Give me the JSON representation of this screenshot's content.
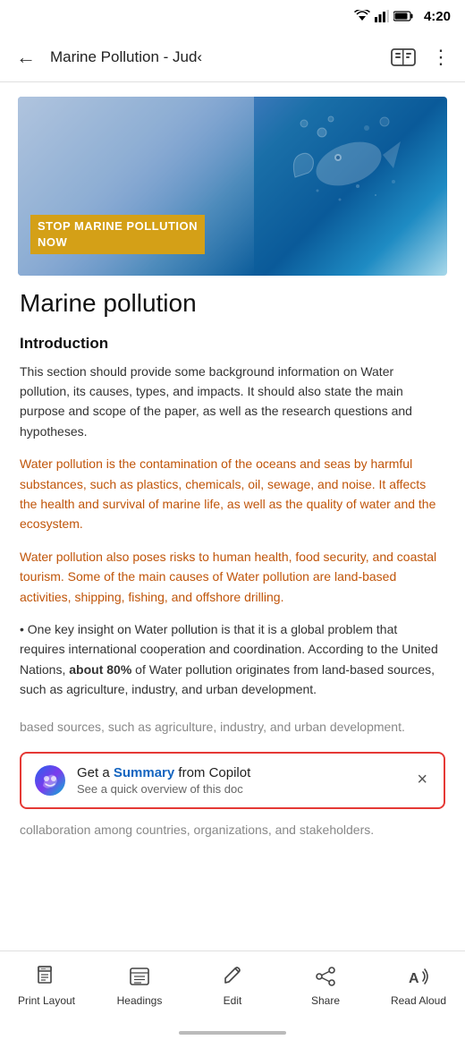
{
  "statusBar": {
    "time": "4:20"
  },
  "topBar": {
    "backLabel": "←",
    "title": "Marine Pollution - Jud‹",
    "moreLabel": "⋮"
  },
  "hero": {
    "badgeText": "STOP MARINE POLLUTION\nNOW"
  },
  "document": {
    "mainTitle": "Marine pollution",
    "sectionTitle": "Introduction",
    "paragraph1": "This section should provide some background information on Water pollution, its causes, types, and impacts. It should also state the main purpose and scope of the paper, as well as the research questions and hypotheses.",
    "paragraph2": "Water pollution is the contamination of the oceans and seas by harmful substances, such as plastics, chemicals, oil, sewage, and noise. It affects the health and survival of marine life, as well as the quality of water and the ecosystem.",
    "paragraph3": "Water pollution also poses risks to human health, food security, and coastal tourism. Some of the main causes of Water pollution are land-based activities, shipping, fishing, and offshore drilling.",
    "paragraph4Start": "• One key insight on Water pollution is that it is a global problem that requires international cooperation and coordination. According to the United Nations, ",
    "paragraph4Bold": "about 80%",
    "paragraph4End": " of Water pollution originates from land-based sources, such as agriculture, industry, and urban development.",
    "paragraph4Faded": "based sources, such as agriculture, industry, and urban development.",
    "fadedBottom": "collaboration among countries, organizations, and stakeholders."
  },
  "copilotBanner": {
    "titleStart": "Get a ",
    "titleHighlight": "Summary",
    "titleEnd": " from Copilot",
    "subtitle": "See a quick overview of this doc",
    "closeLabel": "×"
  },
  "toolbar": {
    "items": [
      {
        "id": "print-layout",
        "label": "Print\nLayout",
        "iconType": "print-layout"
      },
      {
        "id": "headings",
        "label": "Headings",
        "iconType": "headings"
      },
      {
        "id": "edit",
        "label": "Edit",
        "iconType": "edit"
      },
      {
        "id": "share",
        "label": "Share",
        "iconType": "share"
      },
      {
        "id": "read-aloud",
        "label": "Read Aloud",
        "iconType": "read-aloud"
      }
    ]
  }
}
